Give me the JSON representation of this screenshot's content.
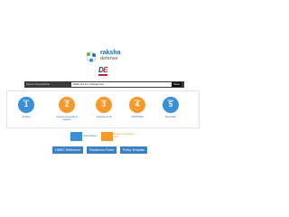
{
  "brand": {
    "line1": "raksha",
    "line2": "defense"
  },
  "badge": {
    "left": "D",
    "right": "E",
    "sub": ""
  },
  "selector": {
    "label": "Select Organization",
    "value": "MAE Hi-Line Chargement",
    "button": "Save"
  },
  "cards": [
    {
      "level_label": "Phase",
      "number": "1",
      "name": "Scoping",
      "color": "#3b8fd6"
    },
    {
      "level_label": "Phase",
      "number": "2",
      "name": "Assessment Guide & Analysis",
      "color": "#f39a2b"
    },
    {
      "level_label": "Phase",
      "number": "3",
      "name": "Assessment Rt",
      "color": "#f39a2b"
    },
    {
      "level_label": "Phase",
      "number": "4",
      "name": "SSP/POAM",
      "color": "#f39a2b"
    },
    {
      "level_label": "Phase",
      "number": "5",
      "name": "Remediate",
      "color": "#3b8fd6"
    }
  ],
  "legend": [
    {
      "label": "Started/Begin",
      "color": "#3b8fd6"
    },
    {
      "label": "Pending / Incomplete status",
      "color": "#f39a2b"
    }
  ],
  "buttons": {
    "cmmc": "CMMC Reference",
    "readiness": "Readiness Portal",
    "policy": "Policy Template"
  }
}
